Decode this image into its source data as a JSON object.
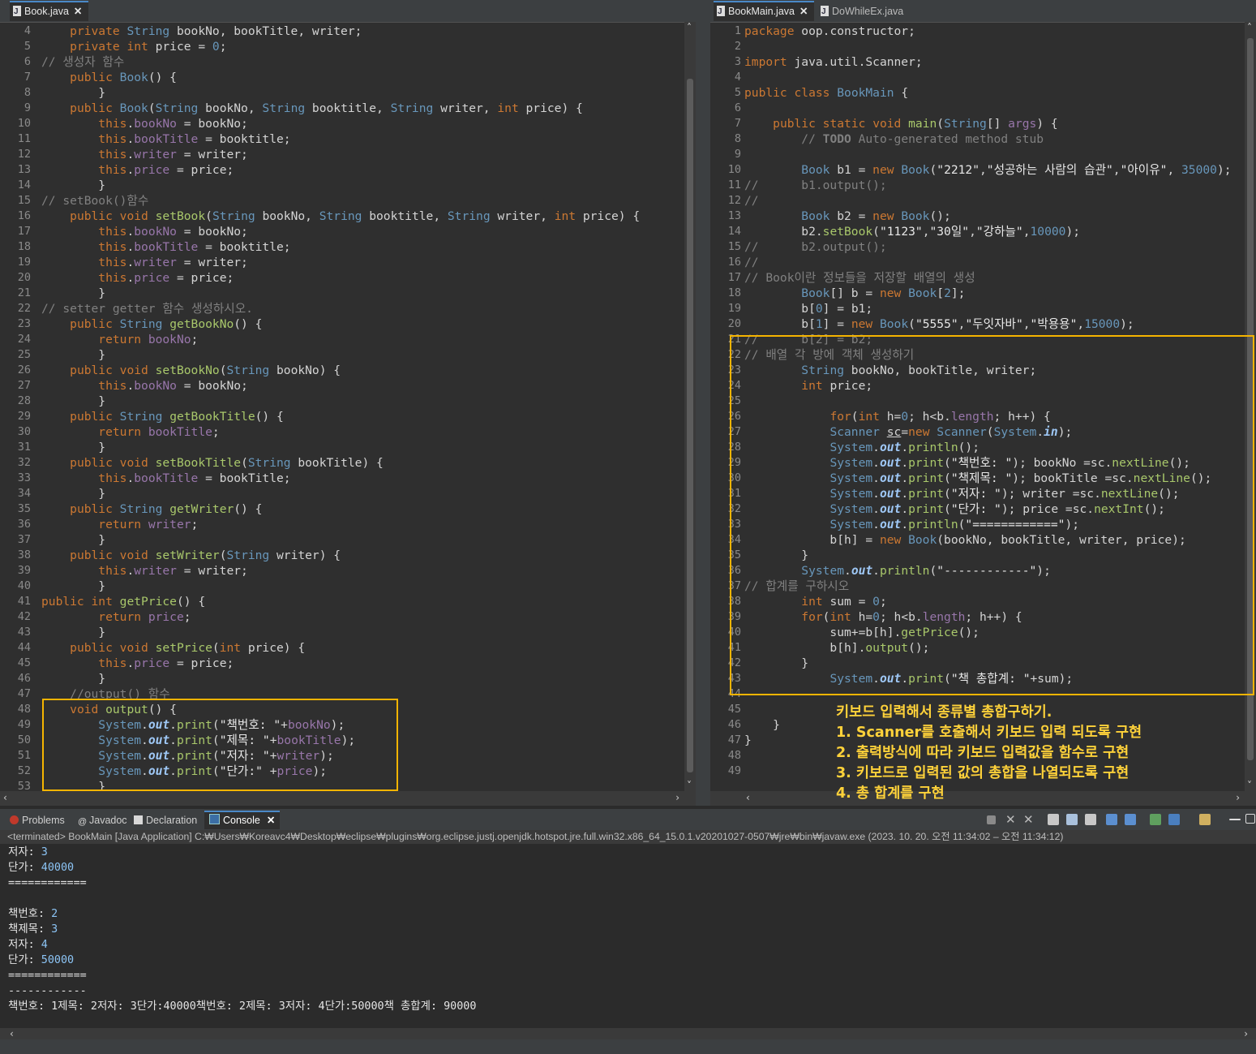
{
  "left_editor": {
    "tab": "Book.java",
    "lines": [
      {
        "n": "4",
        "h": "    <span class=\"kw\">private</span> <span class=\"ty\">String</span> bookNo, bookTitle, writer;"
      },
      {
        "n": "5",
        "h": "    <span class=\"kw\">private</span> <span class=\"kw\">int</span> price = <span class=\"ty\">0</span>;"
      },
      {
        "n": "6",
        "h": "<span class=\"cm\">// 생성자 함수</span>"
      },
      {
        "n": "7",
        "h": "    <span class=\"kw\">public</span> <span class=\"ty\">Book</span>() {"
      },
      {
        "n": "8",
        "h": "        }"
      },
      {
        "n": "9",
        "h": "    <span class=\"kw\">public</span> <span class=\"ty\">Book</span>(<span class=\"ty\">String</span> bookNo, <span class=\"ty\">String</span> booktitle, <span class=\"ty\">String</span> writer, <span class=\"kw\">int</span> price) {"
      },
      {
        "n": "10",
        "h": "        <span class=\"kw\">this</span>.<span class=\"fld\">bookNo</span> = bookNo;"
      },
      {
        "n": "11",
        "h": "        <span class=\"kw\">this</span>.<span class=\"fld\">bookTitle</span> = booktitle;"
      },
      {
        "n": "12",
        "h": "        <span class=\"kw\">this</span>.<span class=\"fld\">writer</span> = writer;"
      },
      {
        "n": "13",
        "h": "        <span class=\"kw\">this</span>.<span class=\"fld\">price</span> = price;"
      },
      {
        "n": "14",
        "h": "        }"
      },
      {
        "n": "15",
        "h": "<span class=\"cm\">// setBook()함수</span>"
      },
      {
        "n": "16",
        "h": "    <span class=\"kw\">public</span> <span class=\"kw\">void</span> <span class=\"mt\">setBook</span>(<span class=\"ty\">String</span> bookNo, <span class=\"ty\">String</span> booktitle, <span class=\"ty\">String</span> writer, <span class=\"kw\">int</span> price) {"
      },
      {
        "n": "17",
        "h": "        <span class=\"kw\">this</span>.<span class=\"fld\">bookNo</span> = bookNo;"
      },
      {
        "n": "18",
        "h": "        <span class=\"kw\">this</span>.<span class=\"fld\">bookTitle</span> = booktitle;"
      },
      {
        "n": "19",
        "h": "        <span class=\"kw\">this</span>.<span class=\"fld\">writer</span> = writer;"
      },
      {
        "n": "20",
        "h": "        <span class=\"kw\">this</span>.<span class=\"fld\">price</span> = price;"
      },
      {
        "n": "21",
        "h": "        }"
      },
      {
        "n": "22",
        "h": "<span class=\"cm\">// setter getter 함수 생성하시오.</span>"
      },
      {
        "n": "23",
        "h": "    <span class=\"kw\">public</span> <span class=\"ty\">String</span> <span class=\"mt\">getBookNo</span>() {"
      },
      {
        "n": "24",
        "h": "        <span class=\"kw\">return</span> <span class=\"fld\">bookNo</span>;"
      },
      {
        "n": "25",
        "h": "        }"
      },
      {
        "n": "26",
        "h": "    <span class=\"kw\">public</span> <span class=\"kw\">void</span> <span class=\"mt\">setBookNo</span>(<span class=\"ty\">String</span> bookNo) {"
      },
      {
        "n": "27",
        "h": "        <span class=\"kw\">this</span>.<span class=\"fld\">bookNo</span> = bookNo;"
      },
      {
        "n": "28",
        "h": "        }"
      },
      {
        "n": "29",
        "h": "    <span class=\"kw\">public</span> <span class=\"ty\">String</span> <span class=\"mt\">getBookTitle</span>() {"
      },
      {
        "n": "30",
        "h": "        <span class=\"kw\">return</span> <span class=\"fld\">bookTitle</span>;"
      },
      {
        "n": "31",
        "h": "        }"
      },
      {
        "n": "32",
        "h": "    <span class=\"kw\">public</span> <span class=\"kw\">void</span> <span class=\"mt\">setBookTitle</span>(<span class=\"ty\">String</span> bookTitle) {"
      },
      {
        "n": "33",
        "h": "        <span class=\"kw\">this</span>.<span class=\"fld\">bookTitle</span> = bookTitle;"
      },
      {
        "n": "34",
        "h": "        }"
      },
      {
        "n": "35",
        "h": "    <span class=\"kw\">public</span> <span class=\"ty\">String</span> <span class=\"mt\">getWriter</span>() {"
      },
      {
        "n": "36",
        "h": "        <span class=\"kw\">return</span> <span class=\"fld\">writer</span>;"
      },
      {
        "n": "37",
        "h": "        }"
      },
      {
        "n": "38",
        "h": "    <span class=\"kw\">public</span> <span class=\"kw\">void</span> <span class=\"mt\">setWriter</span>(<span class=\"ty\">String</span> writer) {"
      },
      {
        "n": "39",
        "h": "        <span class=\"kw\">this</span>.<span class=\"fld\">writer</span> = writer;"
      },
      {
        "n": "40",
        "h": "        }"
      },
      {
        "n": "41",
        "h": "<span class=\"kw\">public</span> <span class=\"kw\">int</span> <span class=\"mt\">getPrice</span>() {"
      },
      {
        "n": "42",
        "h": "        <span class=\"kw\">return</span> <span class=\"fld\">price</span>;"
      },
      {
        "n": "43",
        "h": "        }"
      },
      {
        "n": "44",
        "h": "    <span class=\"kw\">public</span> <span class=\"kw\">void</span> <span class=\"mt\">setPrice</span>(<span class=\"kw\">int</span> price) {"
      },
      {
        "n": "45",
        "h": "        <span class=\"kw\">this</span>.<span class=\"fld\">price</span> = price;"
      },
      {
        "n": "46",
        "h": "        }"
      },
      {
        "n": "47",
        "h": "    <span class=\"cm\">//output() 함수</span>"
      },
      {
        "n": "48",
        "h": "    <span class=\"kw\">void</span> <span class=\"mt\">output</span>() {"
      },
      {
        "n": "49",
        "h": "        <span class=\"ty\">System</span>.<span class=\"out\">out</span>.<span class=\"mt\">print</span>(<span class=\"st\">\"책번호: \"</span>+<span class=\"fld\">bookNo</span>);"
      },
      {
        "n": "50",
        "h": "        <span class=\"ty\">System</span>.<span class=\"out\">out</span>.<span class=\"mt\">print</span>(<span class=\"st\">\"제목: \"</span>+<span class=\"fld\">bookTitle</span>);"
      },
      {
        "n": "51",
        "h": "        <span class=\"ty\">System</span>.<span class=\"out\">out</span>.<span class=\"mt\">print</span>(<span class=\"st\">\"저자: \"</span>+<span class=\"fld\">writer</span>);"
      },
      {
        "n": "52",
        "h": "        <span class=\"ty\">System</span>.<span class=\"out\">out</span>.<span class=\"mt\">print</span>(<span class=\"st\">\"단가:\"</span> +<span class=\"fld\">price</span>);"
      },
      {
        "n": "53",
        "h": "        }"
      }
    ]
  },
  "right_editor": {
    "tabs": [
      "BookMain.java",
      "DoWhileEx.java"
    ],
    "lines": [
      {
        "n": "1",
        "h": "<span class=\"kw\">package</span> oop.constructor;"
      },
      {
        "n": "2",
        "h": ""
      },
      {
        "n": "3",
        "h": "<span class=\"kw\">import</span> java.util.Scanner;"
      },
      {
        "n": "4",
        "h": ""
      },
      {
        "n": "5",
        "h": "<span class=\"kw\">public</span> <span class=\"kw\">class</span> <span class=\"ty\">BookMain</span> {"
      },
      {
        "n": "6",
        "h": ""
      },
      {
        "n": "7",
        "h": "    <span class=\"kw\">public</span> <span class=\"kw\">static</span> <span class=\"kw\">void</span> <span class=\"mt\">main</span>(<span class=\"ty\">String</span>[] <span class=\"fld\">args</span>) {"
      },
      {
        "n": "8",
        "h": "        <span class=\"cm\">// <b>TODO</b> Auto-generated method stub</span>"
      },
      {
        "n": "9",
        "h": ""
      },
      {
        "n": "10",
        "h": "        <span class=\"ty\">Book</span> b1 = <span class=\"kw\">new</span> <span class=\"ty\">Book</span>(<span class=\"st\">\"2212\"</span>,<span class=\"st\">\"성공하는 사람의 습관\"</span>,<span class=\"st\">\"아이유\"</span>, <span class=\"ty\">35000</span>);"
      },
      {
        "n": "11",
        "h": "<span class=\"cm\">//      b1.output();</span>"
      },
      {
        "n": "12",
        "h": "<span class=\"cm\">//</span>"
      },
      {
        "n": "13",
        "h": "        <span class=\"ty\">Book</span> b2 = <span class=\"kw\">new</span> <span class=\"ty\">Book</span>();"
      },
      {
        "n": "14",
        "h": "        b2.<span class=\"mt\">setBook</span>(<span class=\"st\">\"1123\"</span>,<span class=\"st\">\"30일\"</span>,<span class=\"st\">\"강하늘\"</span>,<span class=\"ty\">10000</span>);"
      },
      {
        "n": "15",
        "h": "<span class=\"cm\">//      b2.output();</span>"
      },
      {
        "n": "16",
        "h": "<span class=\"cm\">//</span>"
      },
      {
        "n": "17",
        "h": "<span class=\"cm\">// Book이란 정보들을 저장할 배열의 생성</span>"
      },
      {
        "n": "18",
        "h": "        <span class=\"ty\">Book</span>[] b = <span class=\"kw\">new</span> <span class=\"ty\">Book</span>[<span class=\"ty\">2</span>];"
      },
      {
        "n": "19",
        "h": "        b[<span class=\"ty\">0</span>] = b1;"
      },
      {
        "n": "20",
        "h": "        b[<span class=\"ty\">1</span>] = <span class=\"kw\">new</span> <span class=\"ty\">Book</span>(<span class=\"st\">\"5555\"</span>,<span class=\"st\">\"두잇자바\"</span>,<span class=\"st\">\"박용용\"</span>,<span class=\"ty\">15000</span>);"
      },
      {
        "n": "21",
        "h": "<span class=\"cm\">//      b[2] = b2;</span>"
      },
      {
        "n": "22",
        "h": "<span class=\"cm\">// 배열 각 방에 객체 생성하기</span>"
      },
      {
        "n": "23",
        "h": "        <span class=\"ty\">String</span> bookNo, bookTitle, writer;"
      },
      {
        "n": "24",
        "h": "        <span class=\"kw\">int</span> price;"
      },
      {
        "n": "25",
        "h": ""
      },
      {
        "n": "26",
        "h": "            <span class=\"kw\">for</span>(<span class=\"kw\">int</span> h=<span class=\"ty\">0</span>; h&lt;b.<span class=\"fld\">length</span>; h++) {"
      },
      {
        "n": "27",
        "h": "            <span class=\"ty\">Scanner</span> <u>sc</u>=<span class=\"kw\">new</span> <span class=\"ty\">Scanner</span>(<span class=\"ty\">System</span>.<span class=\"out\">in</span>);"
      },
      {
        "n": "28",
        "h": "            <span class=\"ty\">System</span>.<span class=\"out\">out</span>.<span class=\"mt\">println</span>();"
      },
      {
        "n": "29",
        "h": "            <span class=\"ty\">System</span>.<span class=\"out\">out</span>.<span class=\"mt\">print</span>(<span class=\"st\">\"책번호: \"</span>); bookNo =sc.<span class=\"mt\">nextLine</span>();"
      },
      {
        "n": "30",
        "h": "            <span class=\"ty\">System</span>.<span class=\"out\">out</span>.<span class=\"mt\">print</span>(<span class=\"st\">\"책제목: \"</span>); bookTitle =sc.<span class=\"mt\">nextLine</span>();"
      },
      {
        "n": "31",
        "h": "            <span class=\"ty\">System</span>.<span class=\"out\">out</span>.<span class=\"mt\">print</span>(<span class=\"st\">\"저자: \"</span>); writer =sc.<span class=\"mt\">nextLine</span>();"
      },
      {
        "n": "32",
        "h": "            <span class=\"ty\">System</span>.<span class=\"out\">out</span>.<span class=\"mt\">print</span>(<span class=\"st\">\"단가: \"</span>); price =sc.<span class=\"mt\">nextInt</span>();"
      },
      {
        "n": "33",
        "h": "            <span class=\"ty\">System</span>.<span class=\"out\">out</span>.<span class=\"mt\">println</span>(<span class=\"st\">\"============\"</span>);"
      },
      {
        "n": "34",
        "h": "            b[h] = <span class=\"kw\">new</span> <span class=\"ty\">Book</span>(bookNo, bookTitle, writer, price);"
      },
      {
        "n": "35",
        "h": "        }"
      },
      {
        "n": "36",
        "h": "        <span class=\"ty\">System</span>.<span class=\"out\">out</span>.<span class=\"mt\">println</span>(<span class=\"st\">\"------------\"</span>);"
      },
      {
        "n": "37",
        "h": "<span class=\"cm\">// 합계를 구하시오</span>"
      },
      {
        "n": "38",
        "h": "        <span class=\"kw\">int</span> sum = <span class=\"ty\">0</span>;"
      },
      {
        "n": "39",
        "h": "        <span class=\"kw\">for</span>(<span class=\"kw\">int</span> h=<span class=\"ty\">0</span>; h&lt;b.<span class=\"fld\">length</span>; h++) {"
      },
      {
        "n": "40",
        "h": "            sum+=b[h].<span class=\"mt\">getPrice</span>();"
      },
      {
        "n": "41",
        "h": "            b[h].<span class=\"mt\">output</span>();"
      },
      {
        "n": "42",
        "h": "        }"
      },
      {
        "n": "43",
        "h": "            <span class=\"ty\">System</span>.<span class=\"out\">out</span>.<span class=\"mt\">print</span>(<span class=\"st\">\"책 총합계: \"</span>+sum);"
      },
      {
        "n": "44",
        "h": ""
      },
      {
        "n": "45",
        "h": ""
      },
      {
        "n": "46",
        "h": "    }"
      },
      {
        "n": "47",
        "h": "}"
      },
      {
        "n": "48",
        "h": ""
      },
      {
        "n": "49",
        "h": ""
      }
    ]
  },
  "annotation": {
    "lines": [
      "키보드 입력해서 종류별 총합구하기.",
      "1. Scanner를 호출해서 키보드 입력 되도록 구현",
      "2. 출력방식에 따라 키보드 입력값을 함수로 구현",
      "3. 키보드로 입력된 값의 총합을 나열되도록 구현",
      "4. 총 합계를 구현"
    ]
  },
  "console_panel": {
    "tabs": [
      {
        "label": "Problems",
        "icon": "problems-icon"
      },
      {
        "label": "Javadoc",
        "icon": "javadoc-icon"
      },
      {
        "label": "Declaration",
        "icon": "declaration-icon"
      },
      {
        "label": "Console",
        "icon": "console-icon"
      }
    ],
    "status": "<terminated> BookMain [Java Application] C:₩Users₩Koreavc4₩Desktop₩eclipse₩plugins₩org.eclipse.justj.openjdk.hotspot.jre.full.win32.x86_64_15.0.1.v20201027-0507₩jre₩bin₩javaw.exe  (2023. 10. 20. 오전 11:34:02 – 오전 11:34:12)",
    "output": [
      {
        "label": "저자: ",
        "value": "3"
      },
      {
        "label": "단가: ",
        "value": "40000"
      },
      {
        "label": "============",
        "value": ""
      },
      {
        "label": "",
        "value": ""
      },
      {
        "label": "책번호: ",
        "value": "2"
      },
      {
        "label": "책제목: ",
        "value": "3"
      },
      {
        "label": "저자: ",
        "value": "4"
      },
      {
        "label": "단가: ",
        "value": "50000"
      },
      {
        "label": "============",
        "value": ""
      },
      {
        "label": "------------",
        "value": ""
      },
      {
        "label": "책번호: 1제목: 2저자: 3단가:40000책번호: 2제목: 3저자: 4단가:50000책 총합계: 90000",
        "value": ""
      }
    ]
  },
  "colors": {
    "highlight_box": "#f5b400",
    "annotation_text": "#ffd23a",
    "background": "#2f2f2f"
  }
}
